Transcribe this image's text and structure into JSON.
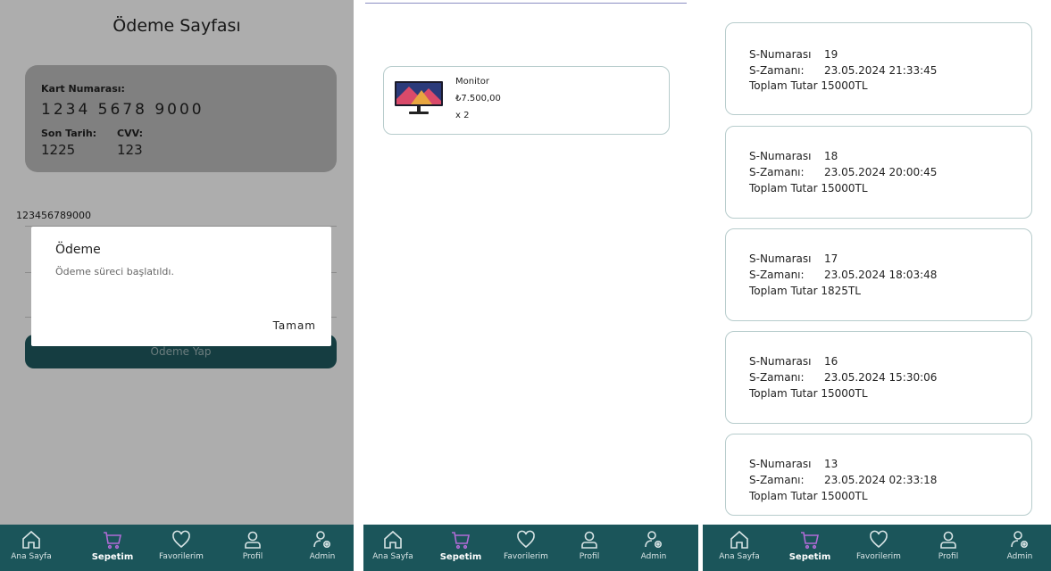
{
  "payment_screen": {
    "title": "Ödeme Sayfası",
    "card": {
      "number_label": "Kart Numarası:",
      "number": "1234 5678 9000",
      "expiry_label": "Son Tarih:",
      "cvv_label": "CVV:",
      "expiry": "1225",
      "cvv": "123"
    },
    "card_input_value": "123456789000",
    "pay_button": "Ödeme Yap",
    "dialog": {
      "title": "Ödeme",
      "message": "Ödeme süreci başlatıldı.",
      "ok": "Tamam"
    }
  },
  "cart_screen": {
    "item": {
      "name": "Monitor",
      "price": "₺7.500,00",
      "quantity": "x 2",
      "image_icon": "monitor-image"
    }
  },
  "orders_screen": {
    "orders": [
      {
        "id_label": "S-Numarası",
        "id": "19",
        "time_label": "S-Zamanı:",
        "time": "23.05.2024 21:33:45",
        "total": "Toplam Tutar 15000TL"
      },
      {
        "id_label": "S-Numarası",
        "id": "18",
        "time_label": "S-Zamanı:",
        "time": "23.05.2024 20:00:45",
        "total": "Toplam Tutar 15000TL"
      },
      {
        "id_label": "S-Numarası",
        "id": "17",
        "time_label": "S-Zamanı:",
        "time": "23.05.2024 18:03:48",
        "total": "Toplam Tutar 1825TL"
      },
      {
        "id_label": "S-Numarası",
        "id": "16",
        "time_label": "S-Zamanı:",
        "time": "23.05.2024 15:30:06",
        "total": "Toplam Tutar 15000TL"
      },
      {
        "id_label": "S-Numarası",
        "id": "13",
        "time_label": "S-Zamanı:",
        "time": "23.05.2024 02:33:18",
        "total": "Toplam Tutar 15000TL"
      }
    ]
  },
  "nav": {
    "items": [
      {
        "label": "Ana Sayfa",
        "icon": "home-icon"
      },
      {
        "label": "Sepetim",
        "icon": "cart-icon",
        "active": true
      },
      {
        "label": "Favorilerim",
        "icon": "heart-icon"
      },
      {
        "label": "Profil",
        "icon": "user-icon"
      },
      {
        "label": "Admin",
        "icon": "admin-icon"
      }
    ]
  },
  "colors": {
    "nav_background": "#1b555a",
    "active_cart_icon": "#b06bd6",
    "card_background": "#bdbdbd",
    "item_border": "#b7cccc"
  }
}
